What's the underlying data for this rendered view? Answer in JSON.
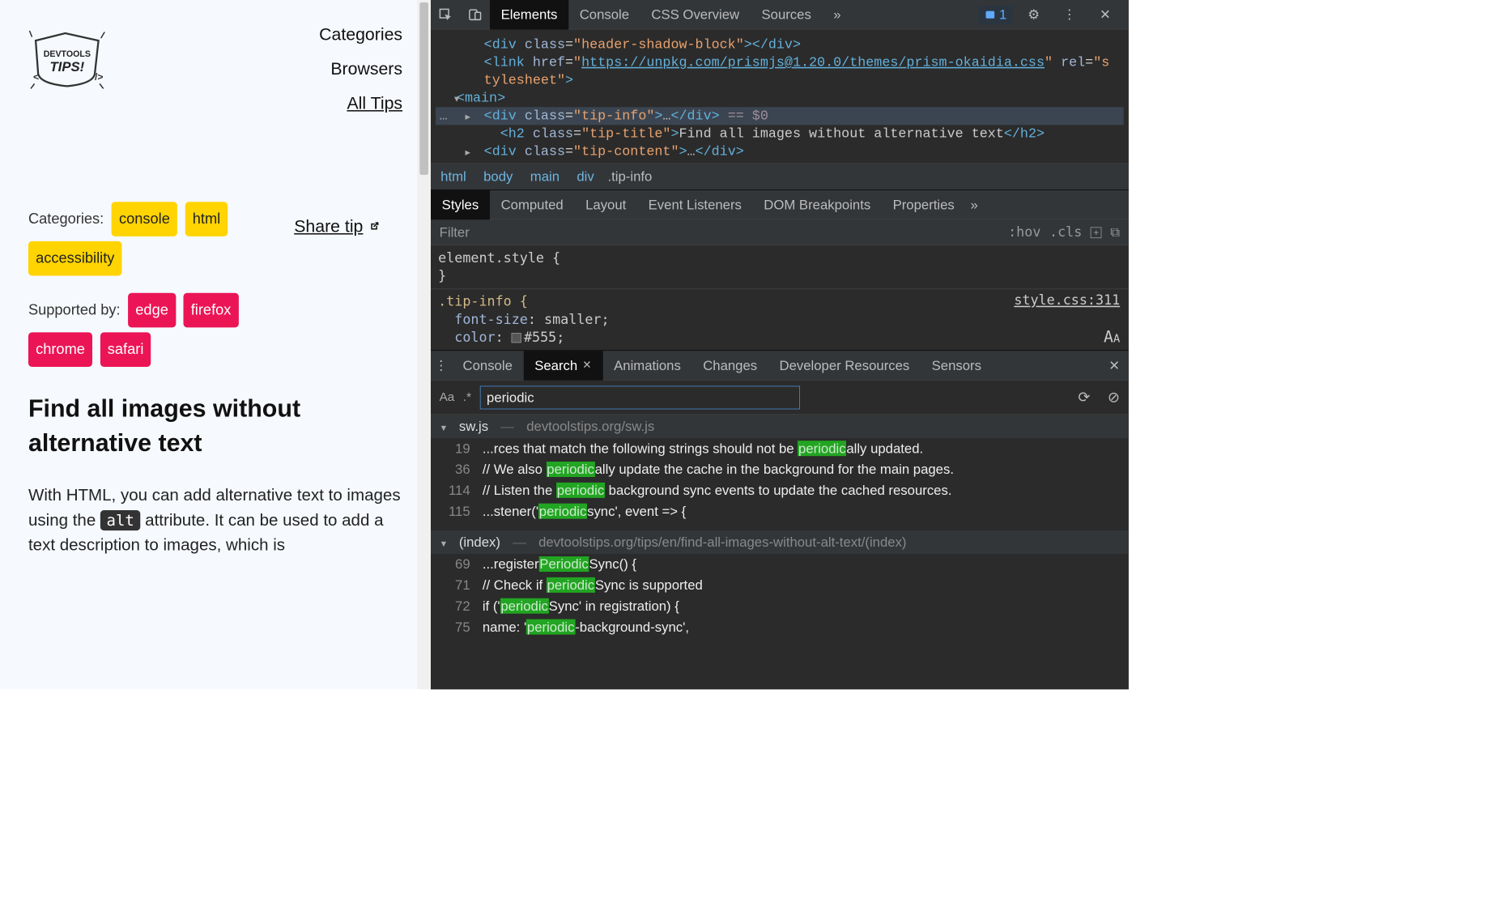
{
  "leftPane": {
    "logoAlt": "DEVTOOLS TIPS!",
    "nav": {
      "categories": "Categories",
      "browsers": "Browsers",
      "allTips": "All Tips"
    },
    "categoriesLabel": "Categories:",
    "categoryTags": [
      "console",
      "html",
      "accessibility"
    ],
    "supportedLabel": "Supported by:",
    "browserTags": [
      "edge",
      "firefox",
      "chrome",
      "safari"
    ],
    "share": "Share tip",
    "title": "Find all images without alternative text",
    "body1": "With HTML, you can add alternative text to images using the ",
    "altCode": "alt",
    "body2": " attribute. It can be used to add a text description to images, which is"
  },
  "devtools": {
    "toolbarTabs": [
      "Elements",
      "Console",
      "CSS Overview",
      "Sources"
    ],
    "activeToolbarTab": 0,
    "issueCount": "1",
    "domLines": [
      {
        "indent": 2,
        "raw": "<div class=\"header-shadow-block\"></div>"
      },
      {
        "indent": 2,
        "raw_link": "<link href=\"https://unpkg.com/prismjs@1.20.0/themes/prism-okaidia.css\" rel=\"s"
      },
      {
        "indent": 2,
        "plain": "tylesheet\">"
      },
      {
        "indent": 1,
        "expander": "open",
        "raw": "<main>"
      },
      {
        "indent": 2,
        "selected": true,
        "expander": "closed",
        "raw_sel": "<div class=\"tip-info\">…</div> == $0"
      },
      {
        "indent": 3,
        "raw_h2": "<h2 class=\"tip-title\">Find all images without alternative text</h2>"
      },
      {
        "indent": 2,
        "expander": "closed",
        "raw_div": "<div class=\"tip-content\">…</div>"
      }
    ],
    "breadcrumb": [
      "html",
      "body",
      "main",
      "div.tip-info"
    ],
    "subTabs": [
      "Styles",
      "Computed",
      "Layout",
      "Event Listeners",
      "DOM Breakpoints",
      "Properties"
    ],
    "activeSubTab": 0,
    "filter": {
      "placeholder": "Filter",
      "hov": ":hov",
      "cls": ".cls"
    },
    "styleRule": {
      "elementStyle": "element.style {",
      "close": "}",
      "selector": ".tip-info {",
      "link": "style.css:311",
      "props": [
        {
          "name": "font-size",
          "value": "smaller;"
        },
        {
          "name": "color",
          "value": "#555;",
          "swatch": "#555"
        }
      ]
    },
    "drawer": {
      "tabs": [
        "Console",
        "Search",
        "Animations",
        "Changes",
        "Developer Resources",
        "Sensors"
      ],
      "activeTab": 1,
      "searchValue": "periodic",
      "results": [
        {
          "file": "sw.js",
          "path": "devtoolstips.org/sw.js",
          "matches": [
            {
              "ln": "19",
              "pre": "...rces that match the following strings should not be ",
              "match": "periodic",
              "post": "ally updated."
            },
            {
              "ln": "36",
              "pre": "// We also ",
              "match": "periodic",
              "post": "ally update the cache in the background for the main pages."
            },
            {
              "ln": "114",
              "pre": "// Listen the ",
              "match": "periodic",
              "post": " background sync events to update the cached resources."
            },
            {
              "ln": "115",
              "pre": "...stener('",
              "match": "periodic",
              "post": "sync', event => {"
            }
          ]
        },
        {
          "file": "(index)",
          "path": "devtoolstips.org/tips/en/find-all-images-without-alt-text/(index)",
          "matches": [
            {
              "ln": "69",
              "pre": "...register",
              "match": "Periodic",
              "post": "Sync() {"
            },
            {
              "ln": "71",
              "pre": "// Check if ",
              "match": "periodic",
              "post": "Sync is supported"
            },
            {
              "ln": "72",
              "pre": "if ('",
              "match": "periodic",
              "post": "Sync' in registration) {"
            },
            {
              "ln": "75",
              "pre": "name: '",
              "match": "periodic",
              "post": "-background-sync',"
            }
          ]
        }
      ]
    }
  }
}
